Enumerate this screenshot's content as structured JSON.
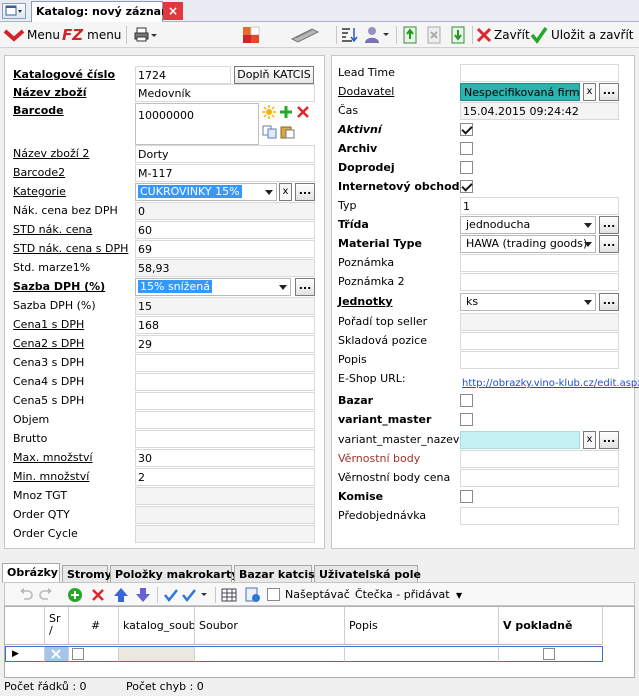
{
  "window": {
    "tab_title": "Katalog: nový záznam",
    "tab_close": "×"
  },
  "toolbar": {
    "menu_label": "Menu",
    "fz_label": "FZ",
    "fz_menu_label": "menu",
    "close_label": "Zavřít",
    "save_close_label": "Uložit a zavřít"
  },
  "left": {
    "katalogove_cislo": {
      "label": "Katalogové číslo",
      "value": "1724"
    },
    "dopln_katcis": "Doplň KATCIS",
    "nazev_zbozi": {
      "label": "Název zboží",
      "value": "Medovník"
    },
    "barcode": {
      "label": "Barcode",
      "value": "10000000"
    },
    "nazev_zbozi_2": {
      "label": "Název zboží 2",
      "value": "Dorty"
    },
    "barcode2": {
      "label": "Barcode2",
      "value": "M-117"
    },
    "kategorie": {
      "label": "Kategorie",
      "value": "CUKROVINKY 15%"
    },
    "nak_cena_bez_dph": {
      "label": "Nák. cena bez DPH",
      "value": "0"
    },
    "std_nak_cena": {
      "label": "STD nák. cena",
      "value": "60"
    },
    "std_nak_cena_s_dph": {
      "label": "STD nák. cena s DPH",
      "value": "69"
    },
    "std_marze": {
      "label": "Std. marze1%",
      "value": "58,93"
    },
    "sazba_dph_select": {
      "label": "Sazba DPH (%)",
      "value": "15% snížená"
    },
    "sazba_dph": {
      "label": "Sazba DPH (%)",
      "value": "15"
    },
    "cena1": {
      "label": "Cena1 s DPH",
      "value": "168"
    },
    "cena2": {
      "label": "Cena2 s DPH",
      "value": "29"
    },
    "cena3": {
      "label": "Cena3 s DPH",
      "value": ""
    },
    "cena4": {
      "label": "Cena4 s DPH",
      "value": ""
    },
    "cena5": {
      "label": "Cena5 s DPH",
      "value": ""
    },
    "objem": {
      "label": "Objem",
      "value": ""
    },
    "brutto": {
      "label": "Brutto",
      "value": ""
    },
    "max_mnozstvi": {
      "label": "Max. množství",
      "value": "30"
    },
    "min_mnozstvi": {
      "label": "Min. množství",
      "value": "2"
    },
    "mnoz_tgt": {
      "label": "Mnoz TGT",
      "value": ""
    },
    "order_qty": {
      "label": "Order QTY",
      "value": ""
    },
    "order_cycle": {
      "label": "Order Cycle",
      "value": ""
    }
  },
  "right": {
    "lead_time": {
      "label": "Lead Time",
      "value": ""
    },
    "dodavatel": {
      "label": "Dodavatel",
      "value": "Nespecifikovaná firma"
    },
    "cas": {
      "label": "Čas",
      "value": "15.04.2015 09:24:42"
    },
    "aktivni": {
      "label": "Aktivní",
      "checked": true
    },
    "archiv": {
      "label": "Archiv",
      "checked": false
    },
    "doprodej": {
      "label": "Doprodej",
      "checked": false
    },
    "internetovy_obchod": {
      "label": "Internetový obchod",
      "checked": true
    },
    "typ": {
      "label": "Typ",
      "value": "1"
    },
    "trida": {
      "label": "Třída",
      "value": "jednoducha"
    },
    "material_type": {
      "label": "Material Type",
      "value": "HAWA (trading goods)"
    },
    "poznamka": {
      "label": "Poznámka",
      "value": ""
    },
    "poznamka2": {
      "label": "Poznámka 2",
      "value": ""
    },
    "jednotky": {
      "label": "Jednotky",
      "value": "ks"
    },
    "poradi_top_seller": {
      "label": "Pořadí top seller",
      "value": ""
    },
    "skladova_pozice": {
      "label": "Skladová pozice",
      "value": ""
    },
    "popis": {
      "label": "Popis",
      "value": ""
    },
    "eshop_url": {
      "label": "E-Shop URL:",
      "value": "http://obrazky.vino-klub.cz/edit.aspx?"
    },
    "bazar": {
      "label": "Bazar",
      "checked": false
    },
    "variant_master": {
      "label": "variant_master",
      "checked": false
    },
    "variant_master_nazev": {
      "label": "variant_master_nazev",
      "value": ""
    },
    "vernostni_body": {
      "label": "Věrnostní body",
      "value": ""
    },
    "vernostni_body_cena": {
      "label": "Věrnostní body cena",
      "value": ""
    },
    "komise": {
      "label": "Komise",
      "checked": false
    },
    "predobjednavka": {
      "label": "Předobjednávka",
      "value": ""
    }
  },
  "bottom_tabs": [
    "Obrázky",
    "Stromy",
    "Položky makrokarty",
    "Bazar katcis",
    "Uživatelská pole"
  ],
  "bottom_toolbar": {
    "naseptavac": "Našeptávač",
    "ctecka": "Čtečka - přidávat"
  },
  "grid": {
    "columns": [
      "Sr /",
      "#",
      "katalog_soubo",
      "Soubor",
      "Popis",
      "V pokladně"
    ]
  },
  "status": {
    "rows": "Počet řádků : 0",
    "errors": "Počet chyb : 0"
  },
  "colors": {
    "accent_red": "#d0242b",
    "selection_blue": "#3399ff",
    "supplier_teal": "#2bb3b0",
    "cyan_field": "#c4f2f4"
  }
}
